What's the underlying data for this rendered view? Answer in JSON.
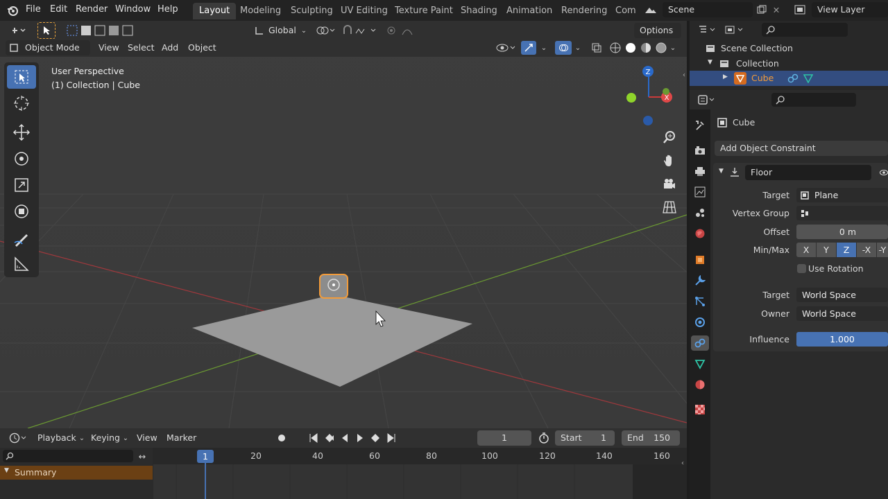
{
  "menu": [
    "File",
    "Edit",
    "Render",
    "Window",
    "Help"
  ],
  "workspaces": [
    "Layout",
    "Modeling",
    "Sculpting",
    "UV Editing",
    "Texture Paint",
    "Shading",
    "Animation",
    "Rendering",
    "Com"
  ],
  "scene_name": "Scene",
  "view_layer": "View Layer",
  "header": {
    "transform_orientation": "Global",
    "options": "Options",
    "mode": "Object Mode",
    "view": "View",
    "select": "Select",
    "add": "Add",
    "object": "Object"
  },
  "overlay": {
    "perspective": "User Perspective",
    "collection": "(1) Collection | Cube"
  },
  "gizmo": {
    "z": "Z",
    "x": "X"
  },
  "outliner": {
    "scene_collection": "Scene Collection",
    "collection": "Collection",
    "cube": "Cube"
  },
  "props": {
    "object_name": "Cube",
    "add_constraint": "Add Object Constraint",
    "constraint_name": "Floor",
    "target_label": "Target",
    "target_value": "Plane",
    "vertex_group_label": "Vertex Group",
    "offset_label": "Offset",
    "offset_value": "0 m",
    "minmax_label": "Min/Max",
    "axes": [
      "X",
      "Y",
      "Z",
      "-X",
      "-Y"
    ],
    "use_rotation": "Use Rotation",
    "target_space_label": "Target",
    "target_space": "World Space",
    "owner_space_label": "Owner",
    "owner_space": "World Space",
    "influence_label": "Influence",
    "influence_value": "1.000"
  },
  "timeline": {
    "playback": "Playback",
    "keying": "Keying",
    "view": "View",
    "marker": "Marker",
    "current_frame": "1",
    "start_label": "Start",
    "start": "1",
    "end_label": "End",
    "end": "150",
    "frame_marks": [
      "20",
      "40",
      "60",
      "80",
      "100",
      "120",
      "140",
      "160"
    ],
    "playhead": "1",
    "summary": "Summary"
  },
  "colors": {
    "accent": "#4772b3",
    "selected_orange": "#f29b3a",
    "x_axis": "#a0383c",
    "y_axis": "#6b9a32"
  }
}
